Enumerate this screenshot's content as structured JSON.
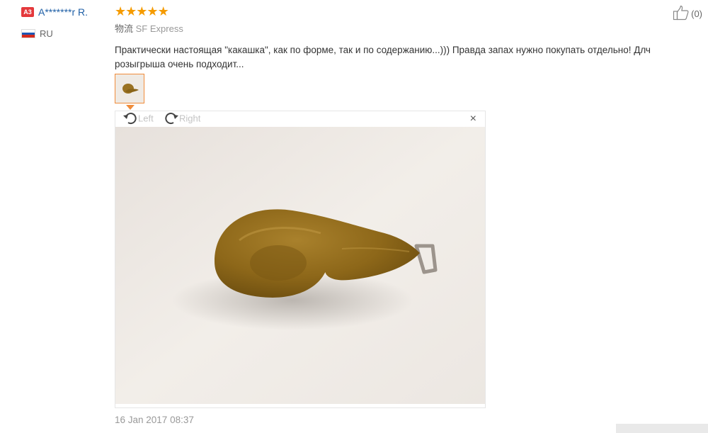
{
  "user": {
    "badge": "A3",
    "name": "A*******r R.",
    "country_code": "RU",
    "flag_icon": "russia-flag-icon"
  },
  "review": {
    "rating": 5,
    "stars": [
      "★",
      "★",
      "★",
      "★",
      "★"
    ],
    "logistics_label": "物流",
    "logistics_value": "SF Express",
    "text": "Практически настоящая \"какашка\", как по форме, так и по содержанию...))) Правда запах нужно покупать отдельно! Длч розыгрыша очень подходит...",
    "date": "16 Jan 2017 08:37",
    "helpful_count": "(0)"
  },
  "viewer": {
    "rotate_left_label": "Left",
    "rotate_right_label": "Right",
    "close_label": "×"
  },
  "colors": {
    "star": "#f59b00",
    "username": "#1f5fa6",
    "badge": "#e4393c",
    "thumb_border": "#f08c3a"
  }
}
